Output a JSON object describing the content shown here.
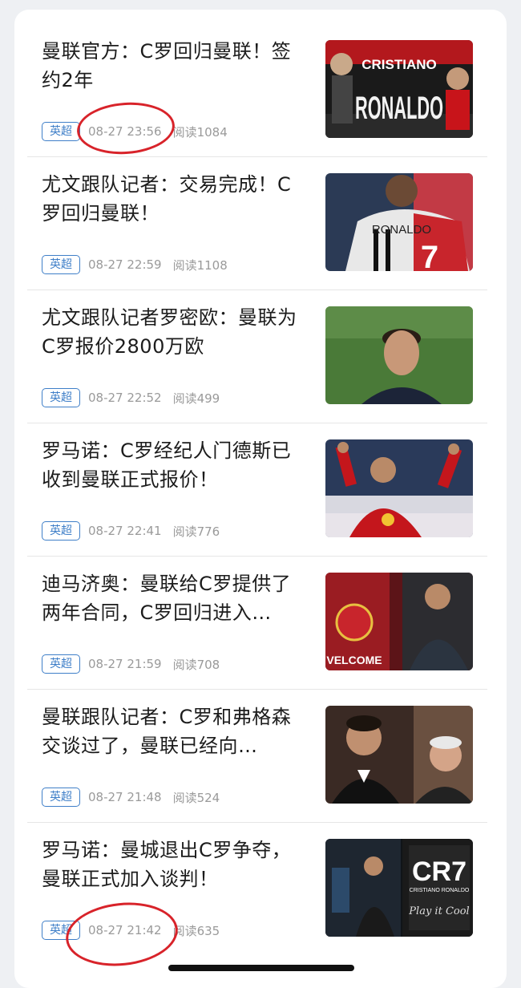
{
  "articles": [
    {
      "title": "曼联官方：C罗回归曼联！签约2年",
      "tag": "英超",
      "time": "08-27 23:56",
      "reads": "阅读1084",
      "image": "cristiano-ronaldo-poster",
      "image_text_1": "CRISTIANO",
      "image_text_2": "RONALDO"
    },
    {
      "title": "尤文跟队记者：交易完成！C罗回归曼联！",
      "tag": "英超",
      "time": "08-27 22:59",
      "reads": "阅读1108",
      "image": "ronaldo-jersey-back",
      "image_text_1": "RONALDO",
      "image_text_2": "7"
    },
    {
      "title": "尤文跟队记者罗密欧：曼联为C罗报价2800万欧",
      "tag": "英超",
      "time": "08-27 22:52",
      "reads": "阅读499",
      "image": "ronaldo-portrait-pitch"
    },
    {
      "title": "罗马诺：C罗经纪人门德斯已收到曼联正式报价！",
      "tag": "英超",
      "time": "08-27 22:41",
      "reads": "阅读776",
      "image": "ronaldo-thumbs-up-red-kit"
    },
    {
      "title": "迪马济奥：曼联给C罗提供了两年合同，C罗回归进入…",
      "tag": "英超",
      "time": "08-27 21:59",
      "reads": "阅读708",
      "image": "old-trafford-welcome",
      "image_text_1": "VELCOME"
    },
    {
      "title": "曼联跟队记者：C罗和弗格森交谈过了，曼联已经向…",
      "tag": "英超",
      "time": "08-27 21:48",
      "reads": "阅读524",
      "image": "ronaldo-and-ferguson"
    },
    {
      "title": "罗马诺：曼城退出C罗争夺，曼联正式加入谈判！",
      "tag": "英超",
      "time": "08-27 21:42",
      "reads": "阅读635",
      "image": "cr7-store",
      "image_text_1": "CR7",
      "image_text_2": "CRISTIANO RONALDO",
      "image_text_3": "Play it Cool"
    }
  ],
  "colors": {
    "tag": "#3f7fc8",
    "annotation_circle": "#d8232a",
    "meta": "#9a9a9a",
    "title": "#1c1c1c"
  }
}
